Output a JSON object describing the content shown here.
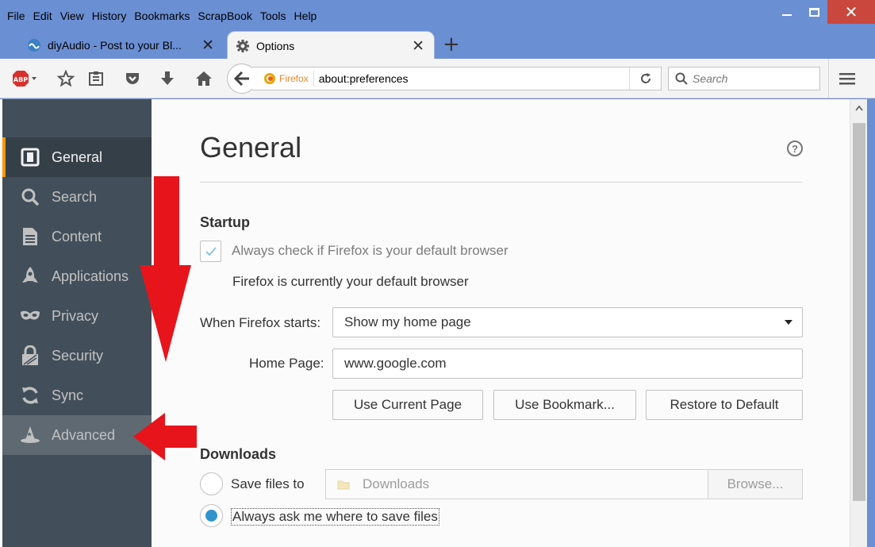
{
  "menubar": {
    "items": [
      {
        "label": "File"
      },
      {
        "label": "Edit"
      },
      {
        "label": "View"
      },
      {
        "label": "History"
      },
      {
        "label": "Bookmarks"
      },
      {
        "label": "ScrapBook"
      },
      {
        "label": "Tools"
      },
      {
        "label": "Help"
      }
    ]
  },
  "tabs": {
    "inactive_title": "diyAudio - Post to your Bl...",
    "active_title": "Options"
  },
  "navbar": {
    "identity_label": "Firefox",
    "url": "about:preferences",
    "search_placeholder": "Search"
  },
  "sidebar": {
    "items": [
      {
        "label": "General",
        "icon": "general-icon"
      },
      {
        "label": "Search",
        "icon": "search-icon"
      },
      {
        "label": "Content",
        "icon": "content-icon"
      },
      {
        "label": "Applications",
        "icon": "applications-icon"
      },
      {
        "label": "Privacy",
        "icon": "privacy-mask-icon"
      },
      {
        "label": "Security",
        "icon": "security-lock-icon"
      },
      {
        "label": "Sync",
        "icon": "sync-icon"
      },
      {
        "label": "Advanced",
        "icon": "advanced-wizard-icon"
      }
    ]
  },
  "main": {
    "title": "General",
    "help": "?",
    "startup": {
      "heading": "Startup",
      "default_check_label": "Always check if Firefox is your default browser",
      "default_status": "Firefox is currently your default browser",
      "when_starts_label": "When Firefox starts:",
      "when_starts_value": "Show my home page",
      "home_page_label": "Home Page:",
      "home_page_value": "www.google.com",
      "btn_current": "Use Current Page",
      "btn_bookmark": "Use Bookmark...",
      "btn_restore": "Restore to Default"
    },
    "downloads": {
      "heading": "Downloads",
      "save_to_label": "Save files to",
      "folder": "Downloads",
      "browse": "Browse...",
      "ask_label": "Always ask me where to save files"
    }
  },
  "colors": {
    "titlebar": "#6b8fd3",
    "sidebar_bg": "#424f5a",
    "sidebar_selected": "#343f48",
    "accent_orange": "#ff9500",
    "radio_blue": "#3294cd",
    "annotation_red": "#e8141b"
  }
}
